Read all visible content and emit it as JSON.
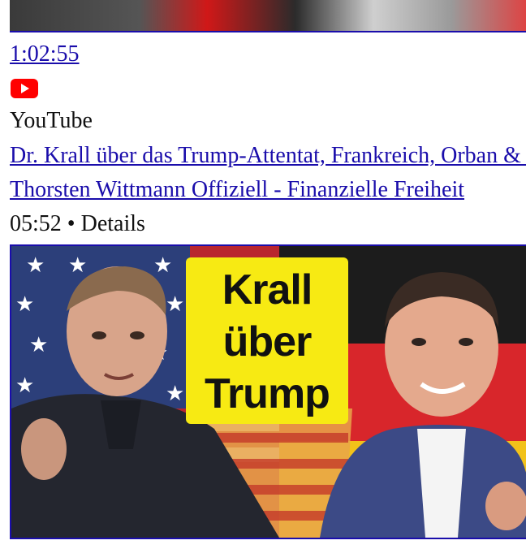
{
  "previous_result": {
    "duration": "1:02:55",
    "icon": "youtube-icon",
    "source": "YouTube"
  },
  "result": {
    "title": "Dr. Krall über das Trump-Attentat, Frankreich, Orban & Co",
    "channel": "Thorsten Wittmann Offiziell - Finanzielle Freiheit",
    "duration": "05:52",
    "separator": "•",
    "details_label": "Details",
    "thumbnail_caption": [
      "Krall",
      "über",
      "Trump"
    ]
  },
  "colors": {
    "link": "#1a0dab",
    "youtube_red": "#ff0000",
    "caption_yellow": "#f7ea13"
  }
}
